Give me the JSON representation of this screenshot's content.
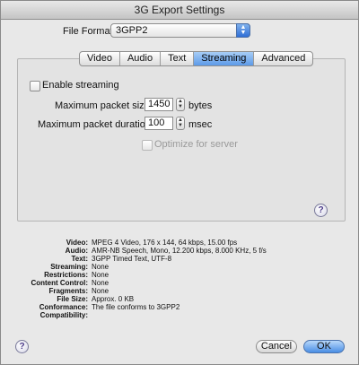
{
  "window": {
    "title": "3G Export Settings"
  },
  "file_format": {
    "label": "File Format:",
    "value": "3GPP2"
  },
  "tabs": [
    {
      "label": "Video"
    },
    {
      "label": "Audio"
    },
    {
      "label": "Text"
    },
    {
      "label": "Streaming"
    },
    {
      "label": "Advanced"
    }
  ],
  "streaming": {
    "enable_label": "Enable streaming",
    "packet_size_label": "Maximum packet size:",
    "packet_size_value": "1450",
    "packet_size_unit": "bytes",
    "duration_label": "Maximum packet duration:",
    "duration_value": "100",
    "duration_unit": "msec",
    "optimize_label": "Optimize for server"
  },
  "summary": [
    {
      "key": "Video:",
      "value": "MPEG 4 Video, 176 x 144, 64 kbps, 15.00 fps"
    },
    {
      "key": "Audio:",
      "value": "AMR-NB Speech, Mono, 12.200 kbps, 8.000 KHz, 5 f/s"
    },
    {
      "key": "Text:",
      "value": "3GPP Timed Text, UTF-8"
    },
    {
      "key": "Streaming:",
      "value": "None"
    },
    {
      "key": "Restrictions:",
      "value": "None"
    },
    {
      "key": "Content Control:",
      "value": "None"
    },
    {
      "key": "Fragments:",
      "value": "None"
    },
    {
      "key": "File Size:",
      "value": "Approx. 0 KB"
    },
    {
      "key": "Conformance:",
      "value": "The file conforms to 3GPP2"
    },
    {
      "key": "Compatibility:",
      "value": ""
    }
  ],
  "buttons": {
    "cancel": "Cancel",
    "ok": "OK",
    "help": "?"
  }
}
